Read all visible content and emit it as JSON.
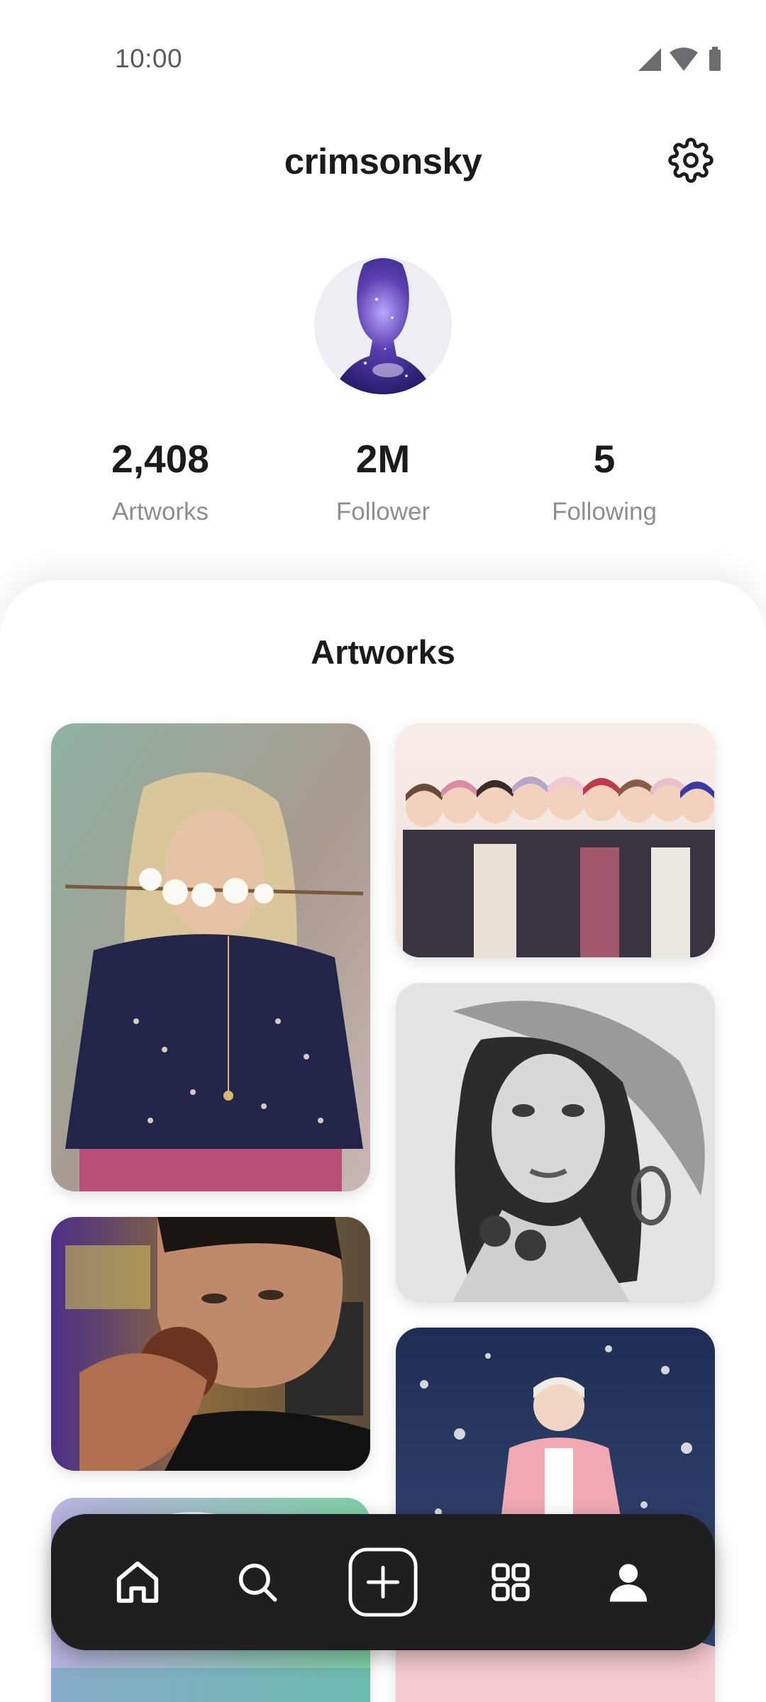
{
  "status_bar": {
    "time": "10:00",
    "icons": [
      "signal-icon",
      "wifi-icon",
      "battery-icon"
    ]
  },
  "header": {
    "username": "crimsonsky",
    "settings_icon": "gear-icon"
  },
  "profile": {
    "avatar": "avatar"
  },
  "stats": [
    {
      "value": "2,408",
      "label": "Artworks"
    },
    {
      "value": "2M",
      "label": "Follower"
    },
    {
      "value": "5",
      "label": "Following"
    }
  ],
  "artworks": {
    "title": "Artworks"
  },
  "bottom_nav": {
    "items": [
      "home-icon",
      "search-icon",
      "add-icon",
      "grid-icon",
      "profile-icon"
    ],
    "active": "profile-icon"
  },
  "colors": {
    "text": "#1b1b1d",
    "muted": "#8d8d92",
    "nav_bg": "#1f1f21",
    "nav_icon": "#ffffff"
  }
}
